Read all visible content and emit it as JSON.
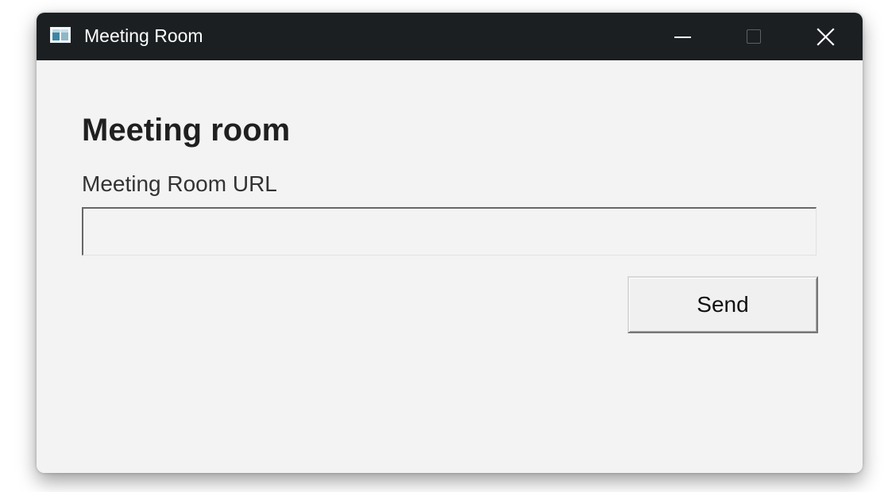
{
  "window": {
    "title": "Meeting Room",
    "icon": "app-window-icon",
    "controls": {
      "minimize_icon": "minimize-icon",
      "maximize_icon": "maximize-icon",
      "close_icon": "close-icon"
    }
  },
  "main": {
    "heading": "Meeting room",
    "url_label": "Meeting Room URL",
    "url_value": "",
    "url_placeholder": "",
    "send_label": "Send"
  },
  "colors": {
    "titlebar": "#1b1f22",
    "content_background": "#f3f3f3",
    "heading_text": "#202020",
    "label_text": "#333333"
  }
}
